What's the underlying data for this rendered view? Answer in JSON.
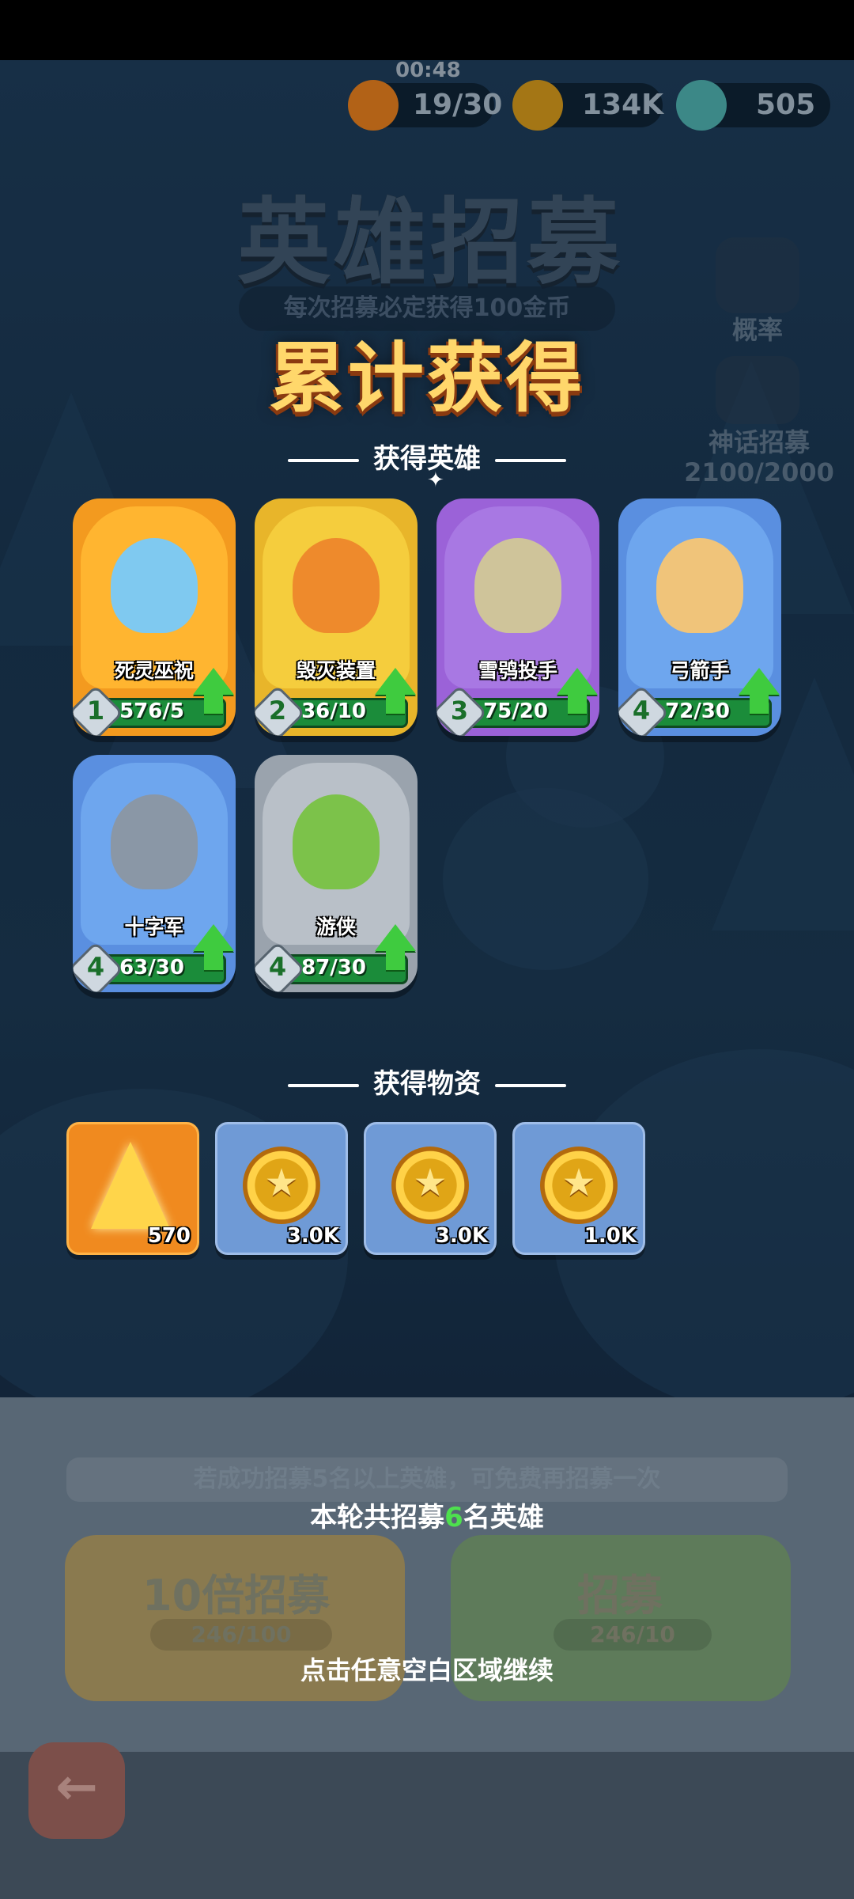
{
  "hud": {
    "timer": "00:48",
    "stamina": "19/30",
    "gold": "134K",
    "gems": "505"
  },
  "background": {
    "title": "英雄招募",
    "subtitle": "每次招募必定获得100金币",
    "side_probability_label": "概率",
    "side_mythic_label": "神话招募",
    "side_mythic_progress": "2100/2000",
    "free_hint": "若成功招募5名以上英雄，可免费再招募一次",
    "ten_recruit_label": "10倍招募",
    "ten_recruit_cost": "246/100",
    "recruit_label": "招募",
    "recruit_cost": "246/10"
  },
  "result": {
    "title": "累计获得",
    "heroes_header": "获得英雄",
    "items_header": "获得物资",
    "summary_prefix": "本轮共招募",
    "summary_count": "6",
    "summary_suffix": "名英雄",
    "continue_hint": "点击任意空白区域继续"
  },
  "heroes": [
    {
      "name": "死灵巫祝",
      "level": "1",
      "progress": "576/5",
      "rarity_color": "#f39a1f"
    },
    {
      "name": "毁灭装置",
      "level": "2",
      "progress": "36/10",
      "rarity_color": "#e8b52a"
    },
    {
      "name": "雪鸮投手",
      "level": "3",
      "progress": "75/20",
      "rarity_color": "#9b62d8"
    },
    {
      "name": "弓箭手",
      "level": "4",
      "progress": "72/30",
      "rarity_color": "#5a8fe0"
    },
    {
      "name": "十字军",
      "level": "4",
      "progress": "63/30",
      "rarity_color": "#5a8fe0"
    },
    {
      "name": "游侠",
      "level": "4",
      "progress": "87/30",
      "rarity_color": "#9aa3ad"
    }
  ],
  "items": [
    {
      "icon": "crystal-icon",
      "count": "570"
    },
    {
      "icon": "gold-coin-icon",
      "count": "3.0K"
    },
    {
      "icon": "gold-coin-icon",
      "count": "3.0K"
    },
    {
      "icon": "gold-coin-icon",
      "count": "1.0K"
    }
  ]
}
